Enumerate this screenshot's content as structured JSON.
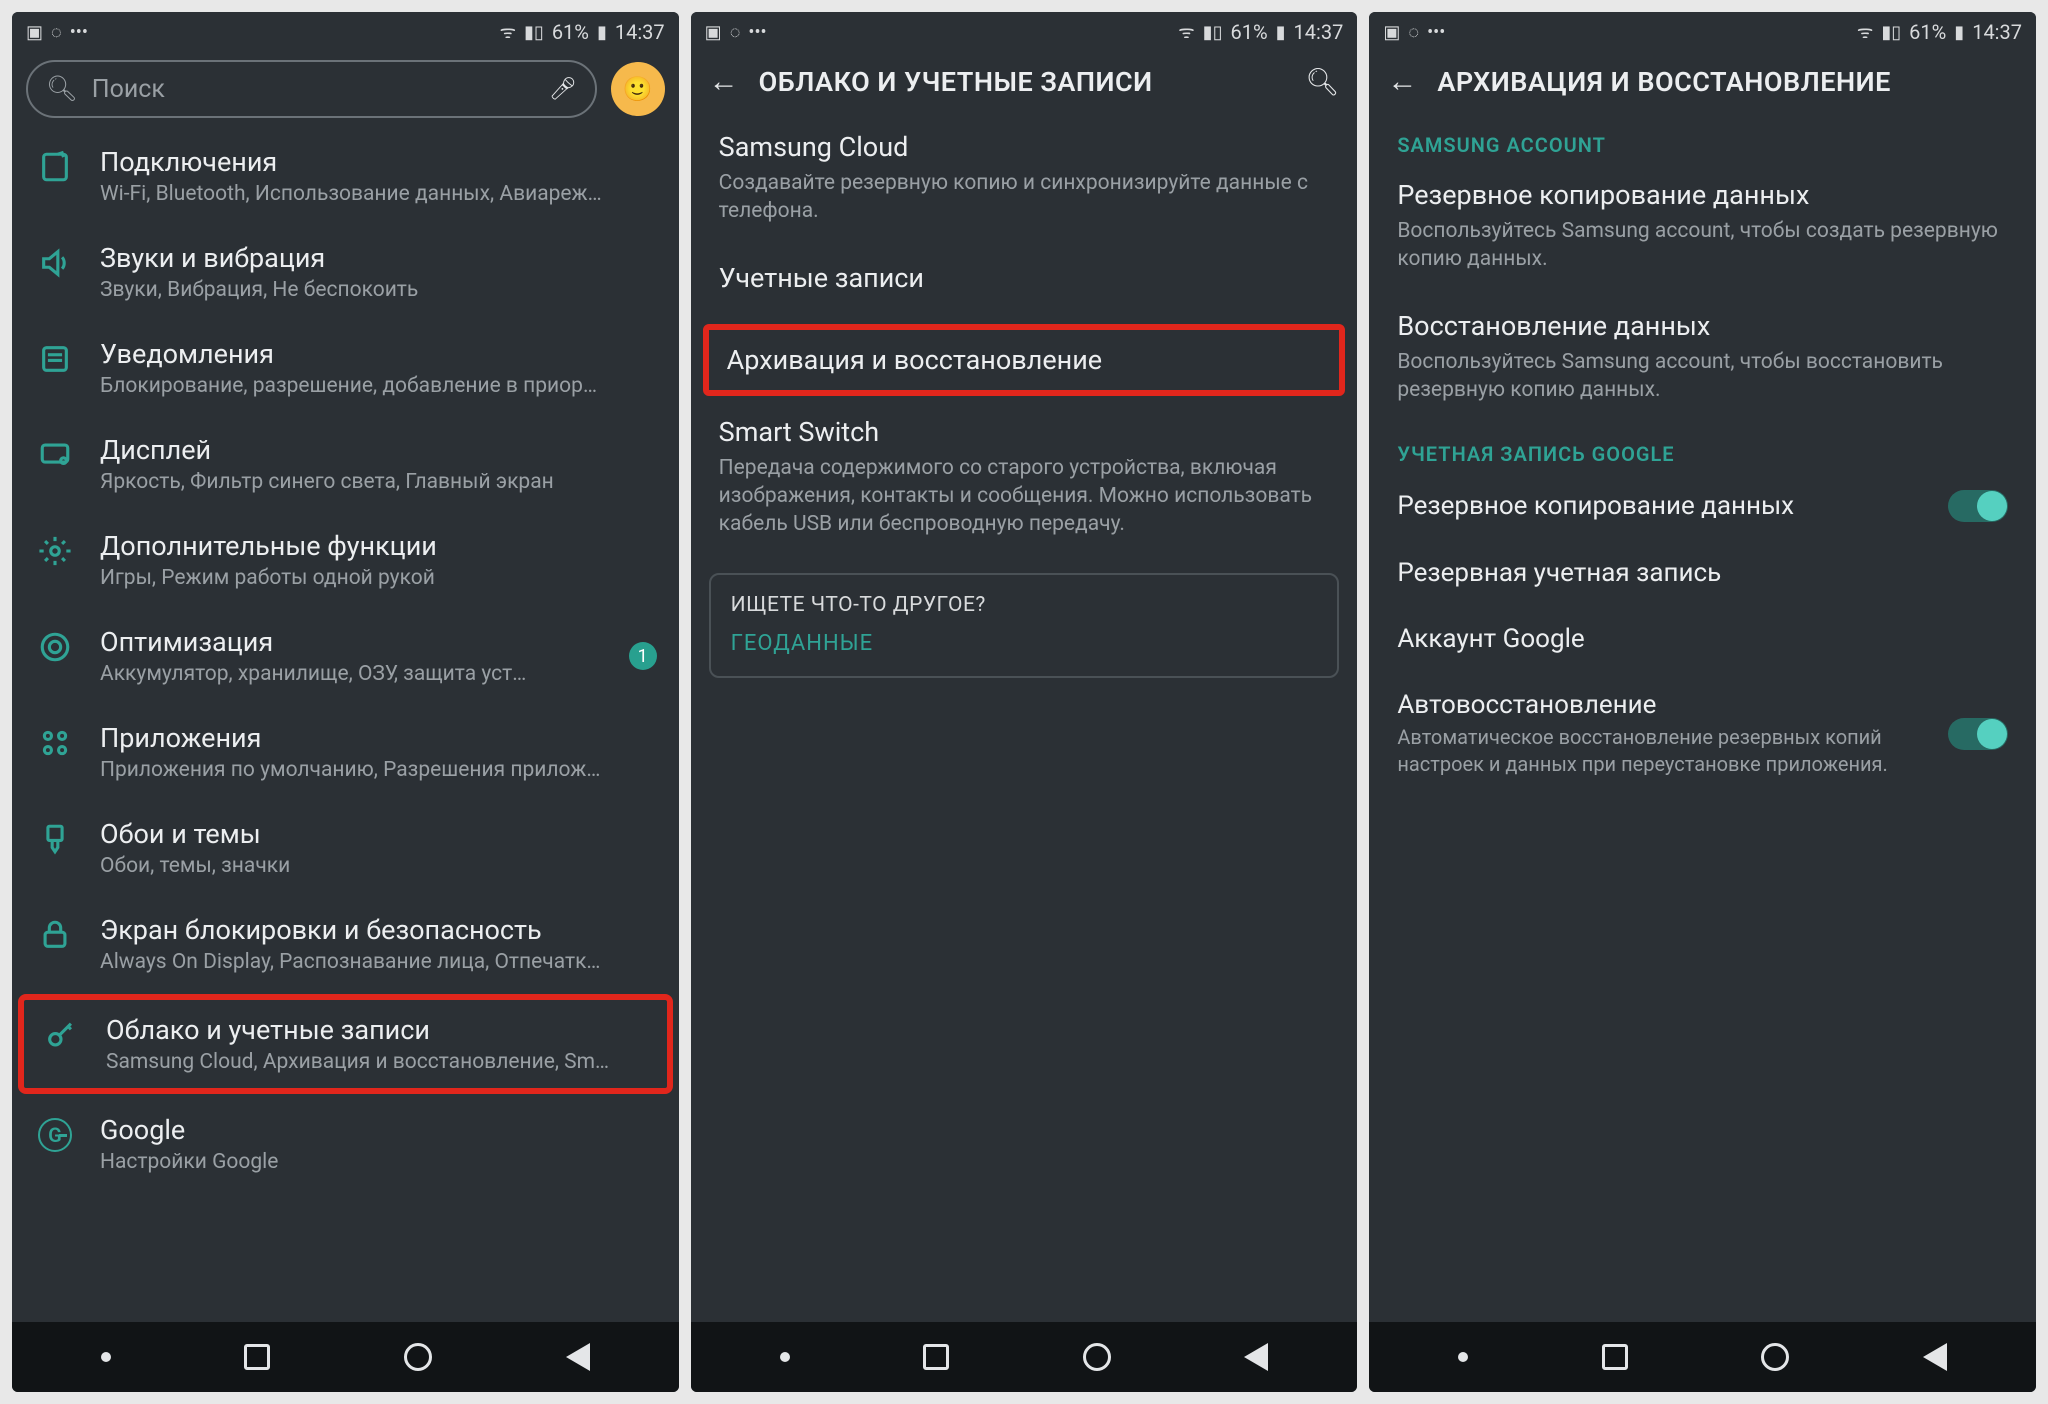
{
  "status": {
    "battery": "61%",
    "time": "14:37"
  },
  "screen1": {
    "search_placeholder": "Поиск",
    "items": [
      {
        "title": "Подключения",
        "sub": "Wi-Fi, Bluetooth, Использование данных, Авиареж…"
      },
      {
        "title": "Звуки и вибрация",
        "sub": "Звуки, Вибрация, Не беспокоить"
      },
      {
        "title": "Уведомления",
        "sub": "Блокирование, разрешение, добавление в приор…"
      },
      {
        "title": "Дисплей",
        "sub": "Яркость, Фильтр синего света, Главный экран"
      },
      {
        "title": "Дополнительные функции",
        "sub": "Игры, Режим работы одной рукой"
      },
      {
        "title": "Оптимизация",
        "sub": "Аккумулятор, хранилище, ОЗУ, защита уст…",
        "badge": "1"
      },
      {
        "title": "Приложения",
        "sub": "Приложения по умолчанию, Разрешения прилож…"
      },
      {
        "title": "Обои и темы",
        "sub": "Обои, темы, значки"
      },
      {
        "title": "Экран блокировки и безопасность",
        "sub": "Always On Display, Распознавание лица, Отпечатк…"
      },
      {
        "title": "Облако и учетные записи",
        "sub": "Samsung Cloud, Архивация и восстановление, Sm…"
      },
      {
        "title": "Google",
        "sub": "Настройки Google"
      }
    ]
  },
  "screen2": {
    "title": "ОБЛАКО И УЧЕТНЫЕ ЗАПИСИ",
    "entries": [
      {
        "title": "Samsung Cloud",
        "sub": "Создавайте резервную копию и синхронизируйте данные с телефона."
      },
      {
        "title": "Учетные записи",
        "sub": ""
      },
      {
        "title": "Архивация и восстановление",
        "sub": ""
      },
      {
        "title": "Smart Switch",
        "sub": "Передача содержимого со старого устройства, включая изображения, контакты и сообщения. Можно использовать кабель USB или беспроводную передачу."
      }
    ],
    "card_title": "ИЩЕТЕ ЧТО-ТО ДРУГОЕ?",
    "card_link": "ГЕОДАННЫЕ"
  },
  "screen3": {
    "title": "АРХИВАЦИЯ И ВОССТАНОВЛЕНИЕ",
    "section_samsung": "SAMSUNG ACCOUNT",
    "samsung_items": [
      {
        "title": "Резервное копирование данных",
        "sub": "Воспользуйтесь Samsung account, чтобы создать резервную копию данных."
      },
      {
        "title": "Восстановление данных",
        "sub": "Воспользуйтесь Samsung account, чтобы восстановить резервную копию данных."
      }
    ],
    "section_google": "УЧЕТНАЯ ЗАПИСЬ GOOGLE",
    "google_items": [
      {
        "title": "Резервное копирование данных",
        "toggle": true
      },
      {
        "title": "Резервная учетная запись"
      },
      {
        "title": "Аккаунт Google"
      },
      {
        "title": "Автовосстановление",
        "sub": "Автоматическое восстановление резервных копий настроек и данных при переустановке приложения.",
        "toggle": true
      }
    ]
  }
}
